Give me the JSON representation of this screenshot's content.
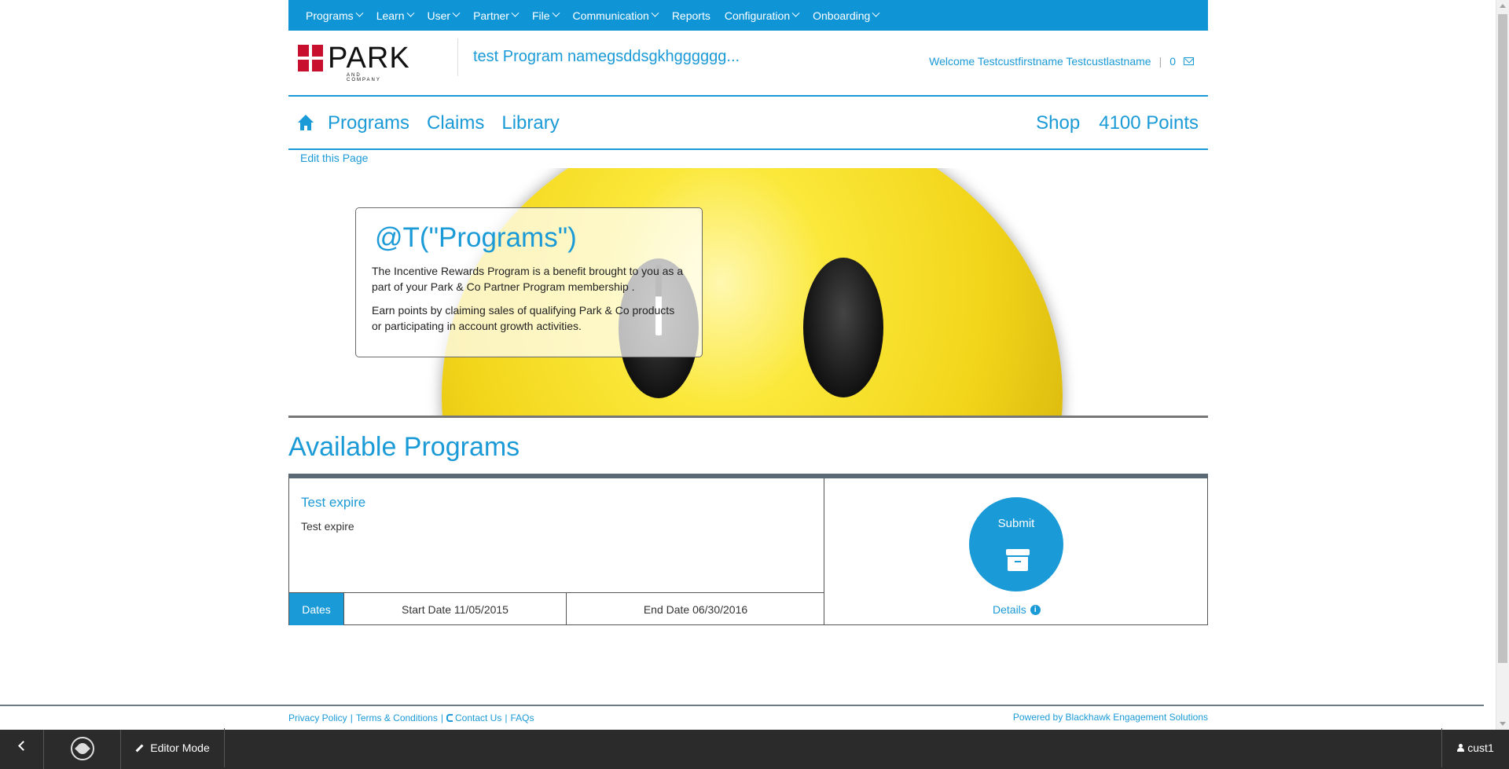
{
  "admin_menu": {
    "items": [
      {
        "label": "Programs",
        "dropdown": true
      },
      {
        "label": "Learn",
        "dropdown": true
      },
      {
        "label": "User",
        "dropdown": true
      },
      {
        "label": "Partner",
        "dropdown": true
      },
      {
        "label": "File",
        "dropdown": true
      },
      {
        "label": "Communication",
        "dropdown": true
      },
      {
        "label": "Reports",
        "dropdown": false
      },
      {
        "label": "Configuration",
        "dropdown": true
      },
      {
        "label": "Onboarding",
        "dropdown": true
      }
    ]
  },
  "header": {
    "logo_text": "PARK",
    "logo_subtext": "AND COMPANY",
    "program_name": "test Program namegsddsgkhgggggg...",
    "welcome": "Welcome Testcustfirstname Testcustlastname",
    "separator": "|",
    "message_count": "0"
  },
  "main_nav": {
    "home_icon": "home-icon",
    "links": [
      "Programs",
      "Claims",
      "Library"
    ],
    "shop": "Shop",
    "points": "4100 Points"
  },
  "edit_page_link": "Edit this Page",
  "promo": {
    "title": "@T(\"Programs\")",
    "paragraph1": "The Incentive Rewards Program is a benefit brought to you as a part of your Park & Co Partner Program membership .",
    "paragraph2": "Earn points by claiming sales of qualifying Park & Co products or participating in account growth activities."
  },
  "available": {
    "title": "Available Programs",
    "program": {
      "title": "Test expire",
      "description": "Test expire",
      "dates_label": "Dates",
      "start_date": "Start Date 11/05/2015",
      "end_date": "End Date 06/30/2016",
      "submit_label": "Submit",
      "submit_icon": "archive-icon",
      "details_label": "Details",
      "details_icon": "info-icon"
    }
  },
  "footer": {
    "privacy": "Privacy Policy",
    "terms": "Terms & Conditions",
    "contact": "Contact Us",
    "faqs": "FAQs",
    "sep": "|",
    "powered_by": "Powered by Blackhawk Engagement Solutions"
  },
  "editor_bar": {
    "editor_mode": "Editor Mode",
    "user": "cust1"
  },
  "colors": {
    "accent": "#1a9ad6",
    "admin_bar": "#0f95d6",
    "editor_bar": "#2b2b2b"
  }
}
